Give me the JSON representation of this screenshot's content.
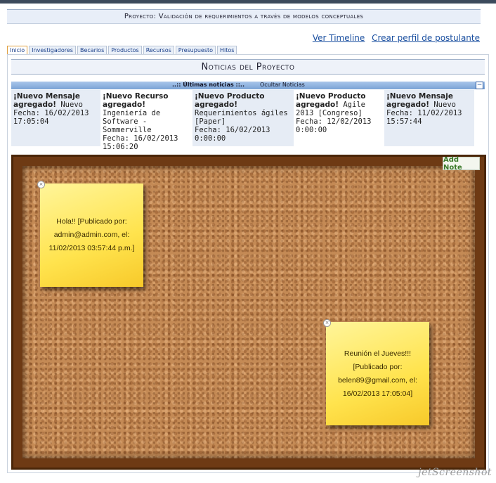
{
  "project_title": "Proyecto: Validación de requerimientos a través de modelos conceptuales",
  "links": {
    "timeline": "Ver Timeline",
    "create_profile": "Crear perfil de postulante"
  },
  "tabs": [
    {
      "label": "Inicio"
    },
    {
      "label": "Investigadores"
    },
    {
      "label": "Becarios"
    },
    {
      "label": "Productos"
    },
    {
      "label": "Recursos"
    },
    {
      "label": "Presupuesto"
    },
    {
      "label": "Hitos"
    }
  ],
  "section_title": "Noticias del Proyecto",
  "news_bar": {
    "title": "..:: Últimas noticias ::..",
    "hide_label": "Ocultar Noticias",
    "collapse_icon": "minus-icon"
  },
  "news": [
    {
      "heading": "¡Nuevo Mensaje agregado!",
      "detail": "Nuevo",
      "date": "Fecha: 16/02/2013 17:05:04"
    },
    {
      "heading": "¡Nuevo Recurso agregado!",
      "detail": "Ingeniería de Software - Sommerville",
      "date": "Fecha: 16/02/2013 15:06:20"
    },
    {
      "heading": "¡Nuevo Producto agregado!",
      "detail": "Requerimientos ágiles [Paper]",
      "date": "Fecha: 16/02/2013 0:00:00"
    },
    {
      "heading": "¡Nuevo Producto agregado!",
      "detail": "Agile 2013 [Congreso]",
      "date": "Fecha: 12/02/2013 0:00:00"
    },
    {
      "heading": "¡Nuevo Mensaje agregado!",
      "detail": "Nuevo",
      "date": "Fecha: 11/02/2013 15:57:44"
    }
  ],
  "board": {
    "add_note_label": "Add Note",
    "notes": [
      {
        "text": "Hola!! [Publicado por: admin@admin.com, el: 11/02/2013 03:57:44 p.m.]"
      },
      {
        "text": "Reunión el Jueves!!! [Publicado por: belen89@gmail.com, el: 16/02/2013 17:05:04]"
      }
    ]
  },
  "watermark": "jetScreenshot"
}
